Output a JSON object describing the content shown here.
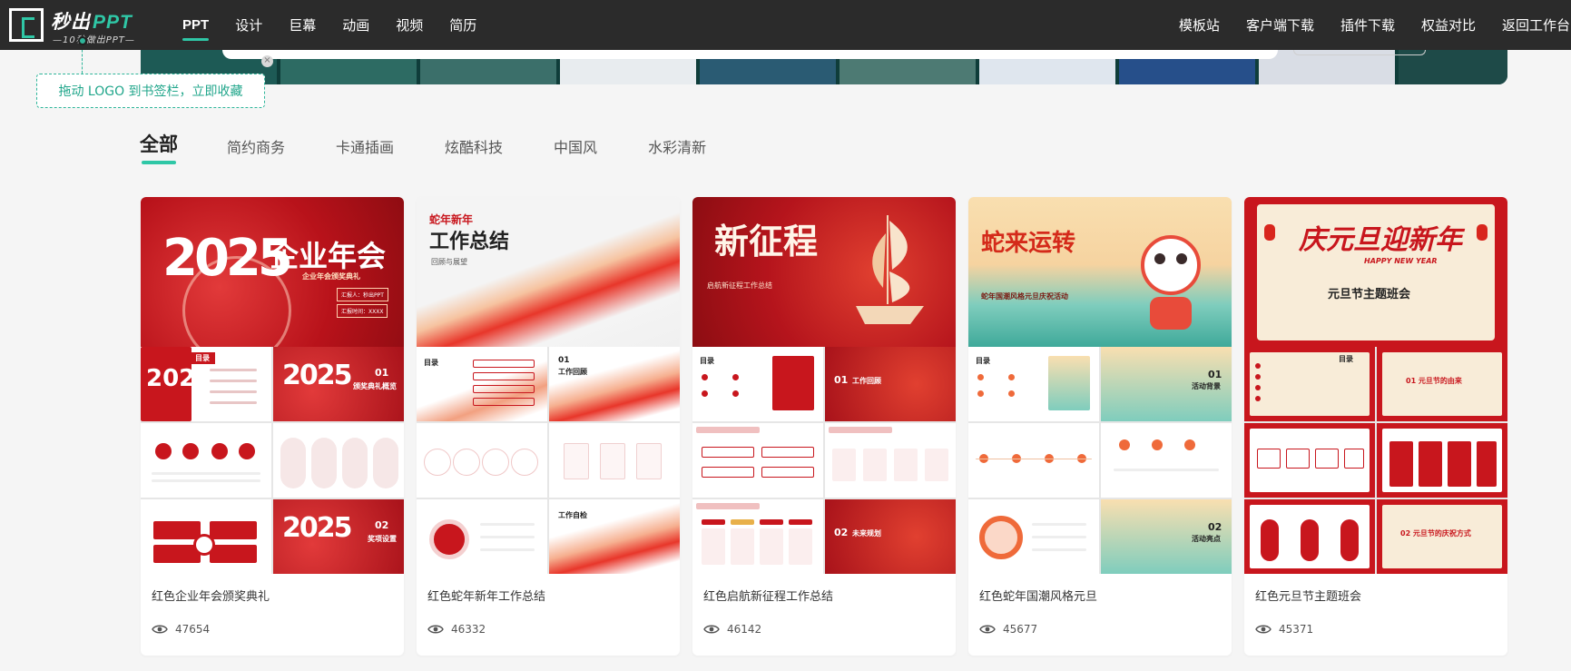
{
  "logo": {
    "title_main": "秒出",
    "title_ppt": "PPT",
    "subtitle": "—10秒做出PPT—"
  },
  "nav": {
    "left": [
      "PPT",
      "设计",
      "巨幕",
      "动画",
      "视频",
      "简历"
    ],
    "right": [
      "模板站",
      "客户端下载",
      "插件下载",
      "权益对比",
      "返回工作台"
    ]
  },
  "tip": {
    "text": "拖动 LOGO 到书签栏，立即收藏",
    "close_glyph": "×"
  },
  "tabs": [
    "全部",
    "简约商务",
    "卡通插画",
    "炫酷科技",
    "中国风",
    "水彩清新"
  ],
  "colors": {
    "accent": "#2fc7a6",
    "navbar_bg": "#2b2b2b",
    "page_bg": "#f5f5f5",
    "template_red": "#c8161d"
  },
  "cards": [
    {
      "title": "红色企业年会颁奖典礼",
      "views": "47654",
      "hero": {
        "year": "2025",
        "heading": "企业年会",
        "sub": "企业年会颁奖典礼",
        "field1": "汇报人：秒出PPT",
        "field2": "汇报时间：XXXX"
      },
      "slides": {
        "toc": "目录",
        "n1": "01",
        "s1": "颁奖典礼概览",
        "n2": "02",
        "s2": "奖项设置"
      }
    },
    {
      "title": "红色蛇年新年工作总结",
      "views": "46332",
      "hero": {
        "tag": "蛇年新年",
        "heading": "工作总结",
        "sub": "回顾与展望"
      },
      "slides": {
        "toc": "目录",
        "n1": "01",
        "s1": "工作回顾",
        "s2": "工作自检"
      }
    },
    {
      "title": "红色启航新征程工作总结",
      "views": "46142",
      "hero": {
        "heading": "新征程",
        "sub": "启航新征程工作总结"
      },
      "slides": {
        "toc": "目录",
        "n1": "01",
        "s1": "工作回顾",
        "n2": "02",
        "s2": "未来规划"
      }
    },
    {
      "title": "红色蛇年国潮风格元旦",
      "views": "45677",
      "hero": {
        "heading": "蛇来运转",
        "sub": "蛇年国潮风格元旦庆祝活动"
      },
      "slides": {
        "toc": "目录",
        "n1": "01",
        "s1": "活动背景",
        "n2": "02",
        "s2": "活动亮点"
      }
    },
    {
      "title": "红色元旦节主题班会",
      "views": "45371",
      "hero": {
        "heading": "庆元旦迎新年",
        "en": "HAPPY NEW YEAR",
        "sub": "元旦节主题班会"
      },
      "slides": {
        "toc": "目录",
        "s1": "01 元旦节的由来",
        "s2": "02 元旦节的庆祝方式"
      }
    }
  ]
}
